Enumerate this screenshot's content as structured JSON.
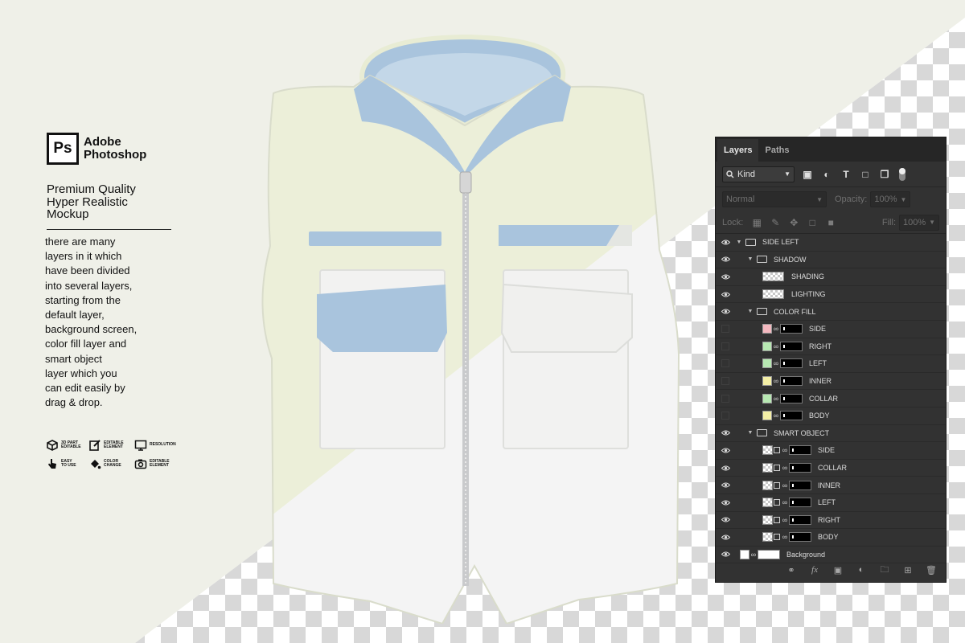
{
  "brand": {
    "logo_text": "Ps",
    "name_line1": "Adobe",
    "name_line2": "Photoshop"
  },
  "headline": [
    "Premium Quality",
    "Hyper Realistic",
    "Mockup"
  ],
  "description": [
    "there are many",
    "layers in it which",
    "have been divided",
    "into several layers,",
    "starting from the",
    "default layer,",
    "background screen,",
    "color fill layer and",
    "smart object",
    "layer which you",
    "can edit easily by",
    "drag & drop."
  ],
  "features": [
    {
      "icon": "3d-cube-icon",
      "line1": "3D PART",
      "line2": "EDITABLE"
    },
    {
      "icon": "edit-pencil-icon",
      "line1": "EDITABLE",
      "line2": "ELEMENT"
    },
    {
      "icon": "monitor-icon",
      "line1": "RESOLUTION",
      "line2": ""
    },
    {
      "icon": "hand-pointer-icon",
      "line1": "EASY",
      "line2": "TO USE"
    },
    {
      "icon": "paint-bucket-icon",
      "line1": "COLOR",
      "line2": "CHANGE"
    },
    {
      "icon": "camera-icon",
      "line1": "EDITABLE",
      "line2": "ELEMENT"
    }
  ],
  "colors": {
    "page_bg": "#eff0e8",
    "vest_cream": "#ecefd9",
    "vest_blue": "#a9c4dd",
    "vest_white": "#f4f4f4",
    "panel_bg": "#323232"
  },
  "panel": {
    "tabs": [
      "Layers",
      "Paths"
    ],
    "kind_label": "Kind",
    "blend_mode": "Normal",
    "opacity_label": "Opacity:",
    "opacity_value": "100%",
    "lock_label": "Lock:",
    "fill_label": "Fill:",
    "fill_value": "100%",
    "layers": {
      "side_left": "SIDE LEFT",
      "shadow": "SHADOW",
      "shading": "SHADING",
      "lighting": "LIGHTING",
      "color_fill": "COLOR FILL",
      "cf_side": "SIDE",
      "cf_right": "RIGHT",
      "cf_left": "LEFT",
      "cf_inner": "INNER",
      "cf_collar": "COLLAR",
      "cf_body": "BODY",
      "smart_object": "SMART OBJECT",
      "so_side": "SIDE",
      "so_collar": "COLLAR",
      "so_inner": "INNER",
      "so_left": "LEFT",
      "so_right": "RIGHT",
      "so_body": "BODY",
      "background": "Background"
    },
    "fill_colors": {
      "side": "#f4b8bf",
      "right": "#b7e8b2",
      "left": "#b7e8b2",
      "inner": "#f4efa6",
      "collar": "#b7e8b2",
      "body": "#f4efa6"
    }
  }
}
